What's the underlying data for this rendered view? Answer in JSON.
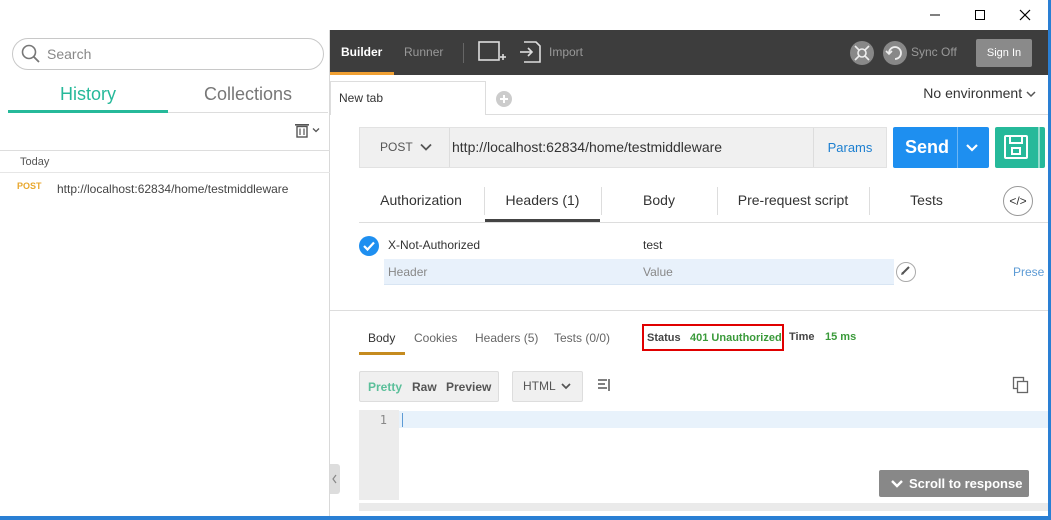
{
  "window": {
    "minimize": "minimize",
    "maximize": "maximize",
    "close": "close"
  },
  "sidebar": {
    "search_placeholder": "Search",
    "tabs": [
      {
        "label": "History"
      },
      {
        "label": "Collections"
      }
    ],
    "group_label": "Today",
    "history": [
      {
        "method": "POST",
        "url": "http://localhost:62834/home/testmiddleware"
      }
    ]
  },
  "toolbar": {
    "builder": "Builder",
    "runner": "Runner",
    "import": "Import",
    "sync": "Sync Off",
    "signin": "Sign In"
  },
  "tabs": {
    "current": "New tab",
    "environment": "No environment"
  },
  "request": {
    "method": "POST",
    "url": "http://localhost:62834/home/testmiddleware",
    "params": "Params",
    "send": "Send",
    "subtabs": [
      "Authorization",
      "Headers (1)",
      "Body",
      "Pre-request script",
      "Tests"
    ],
    "code_label": "</>",
    "headers": [
      {
        "key": "X-Not-Authorized",
        "value": "test"
      }
    ],
    "header_placeholder": "Header",
    "value_placeholder": "Value",
    "presets": "Prese"
  },
  "response": {
    "tabs": [
      "Body",
      "Cookies",
      "Headers (5)",
      "Tests (0/0)"
    ],
    "status_label": "Status",
    "status_value": "401 Unauthorized",
    "time_label": "Time",
    "time_value": "15 ms",
    "formats": [
      "Pretty",
      "Raw",
      "Preview"
    ],
    "language": "HTML",
    "line_number": "1",
    "scroll_label": "Scroll to response"
  },
  "colors": {
    "accent": "#26b99a",
    "send": "#1e8ff0",
    "status_ok": "#3a9a3a",
    "highlight": "#e00000",
    "method_post": "#e8a72c"
  }
}
